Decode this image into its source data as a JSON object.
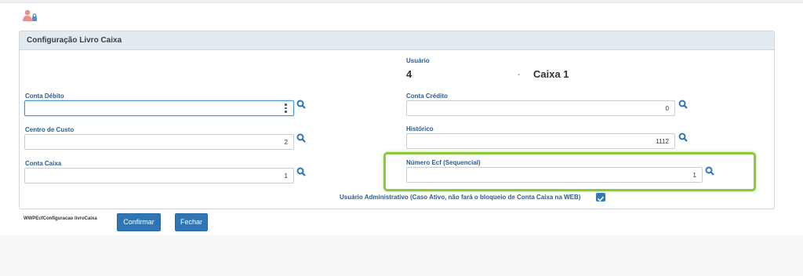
{
  "panel": {
    "title": "Configuração Livro Caixa"
  },
  "usuario": {
    "label": "Usuário",
    "id": "4",
    "separator": "-",
    "name": "Caixa 1"
  },
  "fields": {
    "conta_debito": {
      "label": "Conta Débito",
      "value": ""
    },
    "conta_credito": {
      "label": "Conta Crédito",
      "value": "0"
    },
    "centro_custo": {
      "label": "Centro de Custo",
      "value": "2"
    },
    "historico": {
      "label": "Histórico",
      "value": "1112"
    },
    "conta_caixa": {
      "label": "Conta Caixa",
      "value": "1"
    },
    "numero_ecf": {
      "label": "Número Ecf (Sequencial)",
      "value": "1"
    }
  },
  "admin_checkbox": {
    "label": "Usuário Administrativo (Caso Ativo, não fará o bloqueio de Conta Caixa na WEB)",
    "checked": true
  },
  "footer": {
    "program_name": "WWPEcfConfiguracao livroCaixa",
    "confirm_label": "Confirmar",
    "close_label": "Fechar"
  },
  "icons": {
    "user": "user-lock-icon",
    "search": "search-icon",
    "check": "check-icon"
  },
  "colors": {
    "accent": "#2f74b5",
    "label": "#2a5d8f",
    "highlight": "#8dc63f"
  }
}
